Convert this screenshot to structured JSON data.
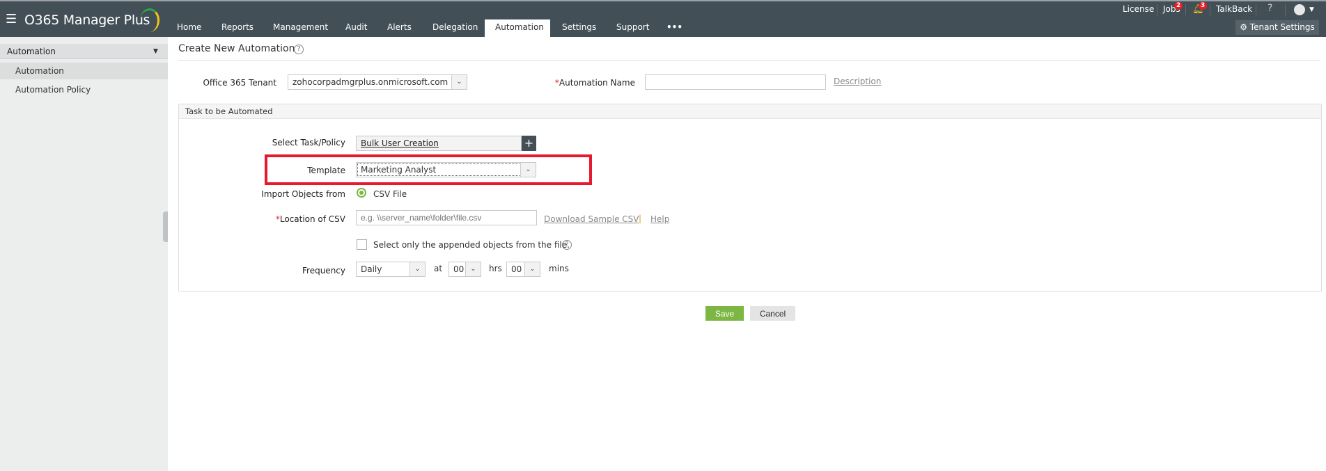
{
  "header": {
    "app_name": "O365 Manager Plus",
    "tabs": [
      "Home",
      "Reports",
      "Management",
      "Audit",
      "Alerts",
      "Delegation",
      "Automation",
      "Settings",
      "Support",
      "•••"
    ],
    "active_tab": "Automation",
    "license": "License",
    "jobs": "Jobs",
    "jobs_badge": "2",
    "alerts_badge": "3",
    "talkback": "TalkBack",
    "help": "?",
    "tenant_settings": "Tenant Settings"
  },
  "sidebar": {
    "section": "Automation",
    "items": [
      "Automation",
      "Automation Policy"
    ],
    "selected": "Automation"
  },
  "page": {
    "title": "Create New Automation",
    "help": "?"
  },
  "form": {
    "tenant_label": "Office 365 Tenant",
    "tenant_value": "zohocorpadmgrplus.onmicrosoft.com",
    "name_label": "Automation Name",
    "name_value": "",
    "description_link": "Description",
    "task_section": "Task to be Automated",
    "task_label": "Select Task/Policy",
    "task_value": "Bulk User Creation",
    "template_label": "Template",
    "template_value": "Marketing Analyst",
    "import_label": "Import Objects from",
    "import_option": "CSV File",
    "csv_label": "Location of CSV",
    "csv_placeholder": "e.g. \\\\server_name\\folder\\file.csv",
    "download_link": "Download Sample CSV",
    "link_sep": "|",
    "help_link": "Help",
    "appended_label": "Select only the appended objects from the file.",
    "appended_checked": false,
    "frequency_label": "Frequency",
    "frequency_value": "Daily",
    "at": "at",
    "hrs_value": "00",
    "hrs": "hrs",
    "mins_value": "00",
    "mins": "mins"
  },
  "actions": {
    "save": "Save",
    "cancel": "Cancel"
  },
  "colors": {
    "header": "#434f57",
    "save": "#7bb742",
    "highlight": "#e8192c"
  }
}
